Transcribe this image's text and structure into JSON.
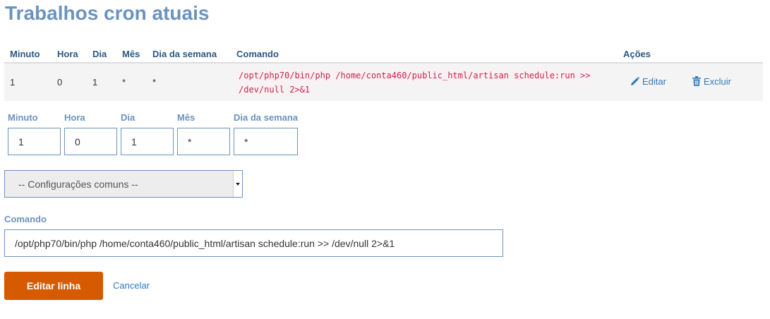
{
  "page_title": "Trabalhos cron atuais",
  "table": {
    "headers": {
      "minute": "Minuto",
      "hour": "Hora",
      "day": "Dia",
      "month": "Mês",
      "weekday": "Dia da semana",
      "command": "Comando",
      "actions": "Ações"
    },
    "row": {
      "minute": "1",
      "hour": "0",
      "day": "1",
      "month": "*",
      "weekday": "*",
      "command_line1": "/opt/php70/bin/php /home/conta460/public_html/artisan schedule:run >>",
      "command_line2": "/dev/null 2>&1",
      "edit_label": "Editar",
      "delete_label": "Excluir"
    }
  },
  "form": {
    "labels": {
      "minute": "Minuto",
      "hour": "Hora",
      "day": "Dia",
      "month": "Mês",
      "weekday": "Dia da semana",
      "command": "Comando"
    },
    "values": {
      "minute": "1",
      "hour": "0",
      "day": "1",
      "month": "*",
      "weekday": "*",
      "command": "/opt/php70/bin/php /home/conta460/public_html/artisan schedule:run >> /dev/null 2>&1"
    },
    "common_settings_select": "-- Configurações comuns --",
    "submit_label": "Editar linha",
    "cancel_label": "Cancelar"
  },
  "colors": {
    "title": "#6b93be",
    "header_text": "#2b5983",
    "link": "#337ab7",
    "primary_button": "#d55a00",
    "code_text": "#c7254e"
  },
  "icons": {
    "edit": "pencil-icon",
    "delete": "trash-icon",
    "select": "chevron-down-icon"
  }
}
